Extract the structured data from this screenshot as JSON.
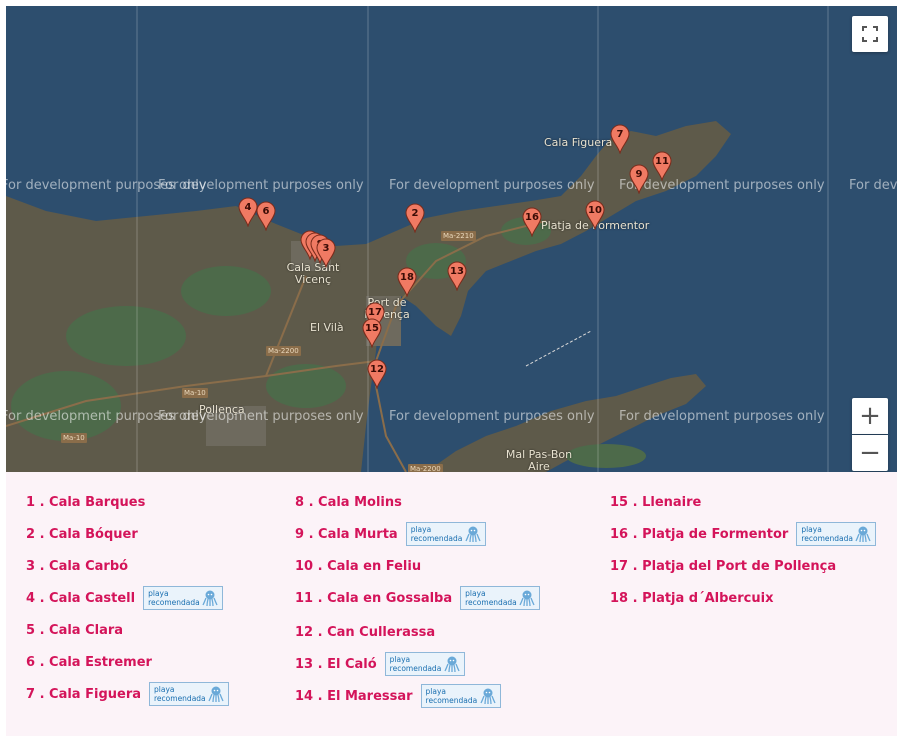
{
  "map": {
    "watermark": "For development purposes only",
    "places": [
      "Cala Figuera",
      "Platja de Formentor",
      "Cala Sant Vicenç",
      "Port de Pollença",
      "El Vilà",
      "Pollença",
      "Mal Pas-Bon Aire"
    ],
    "roads": [
      "Ma-2210",
      "Ma-2200",
      "Ma-10",
      "Ma-2200",
      "Ma-10"
    ],
    "markers": [
      "1",
      "2",
      "3",
      "4",
      "5",
      "6",
      "7",
      "8",
      "9",
      "10",
      "11",
      "12",
      "13",
      "14",
      "15",
      "16",
      "17",
      "18"
    ],
    "controls": {
      "zoom_in": "+",
      "zoom_out": "−"
    },
    "colors": {
      "marker": "#f07a63",
      "sea": "#2d4e6e",
      "land": "#5e5a4a"
    }
  },
  "legend": {
    "badge_text": [
      "playa",
      "recomendada"
    ],
    "items": [
      {
        "label": "1 . Cala Barques",
        "recommended": false
      },
      {
        "label": "2 . Cala Bóquer",
        "recommended": false
      },
      {
        "label": "3 . Cala Carbó",
        "recommended": false
      },
      {
        "label": "4 . Cala Castell",
        "recommended": true
      },
      {
        "label": "5 . Cala Clara",
        "recommended": false
      },
      {
        "label": "6 . Cala Estremer",
        "recommended": false
      },
      {
        "label": "7 . Cala Figuera",
        "recommended": true
      },
      {
        "label": "8 . Cala Molins",
        "recommended": false
      },
      {
        "label": "9 . Cala Murta",
        "recommended": true
      },
      {
        "label": "10 . Cala en Feliu",
        "recommended": false
      },
      {
        "label": "11 . Cala en Gossalba",
        "recommended": true
      },
      {
        "label": "12 . Can Cullerassa",
        "recommended": false
      },
      {
        "label": "13 . El Caló",
        "recommended": true
      },
      {
        "label": "14 . El Maressar",
        "recommended": true
      },
      {
        "label": "15 . Llenaire",
        "recommended": false
      },
      {
        "label": "16 . Platja de Formentor",
        "recommended": true
      },
      {
        "label": "17 . Platja del Port de Pollença",
        "recommended": false
      },
      {
        "label": "18 . Platja d´Albercuix",
        "recommended": false
      }
    ]
  }
}
